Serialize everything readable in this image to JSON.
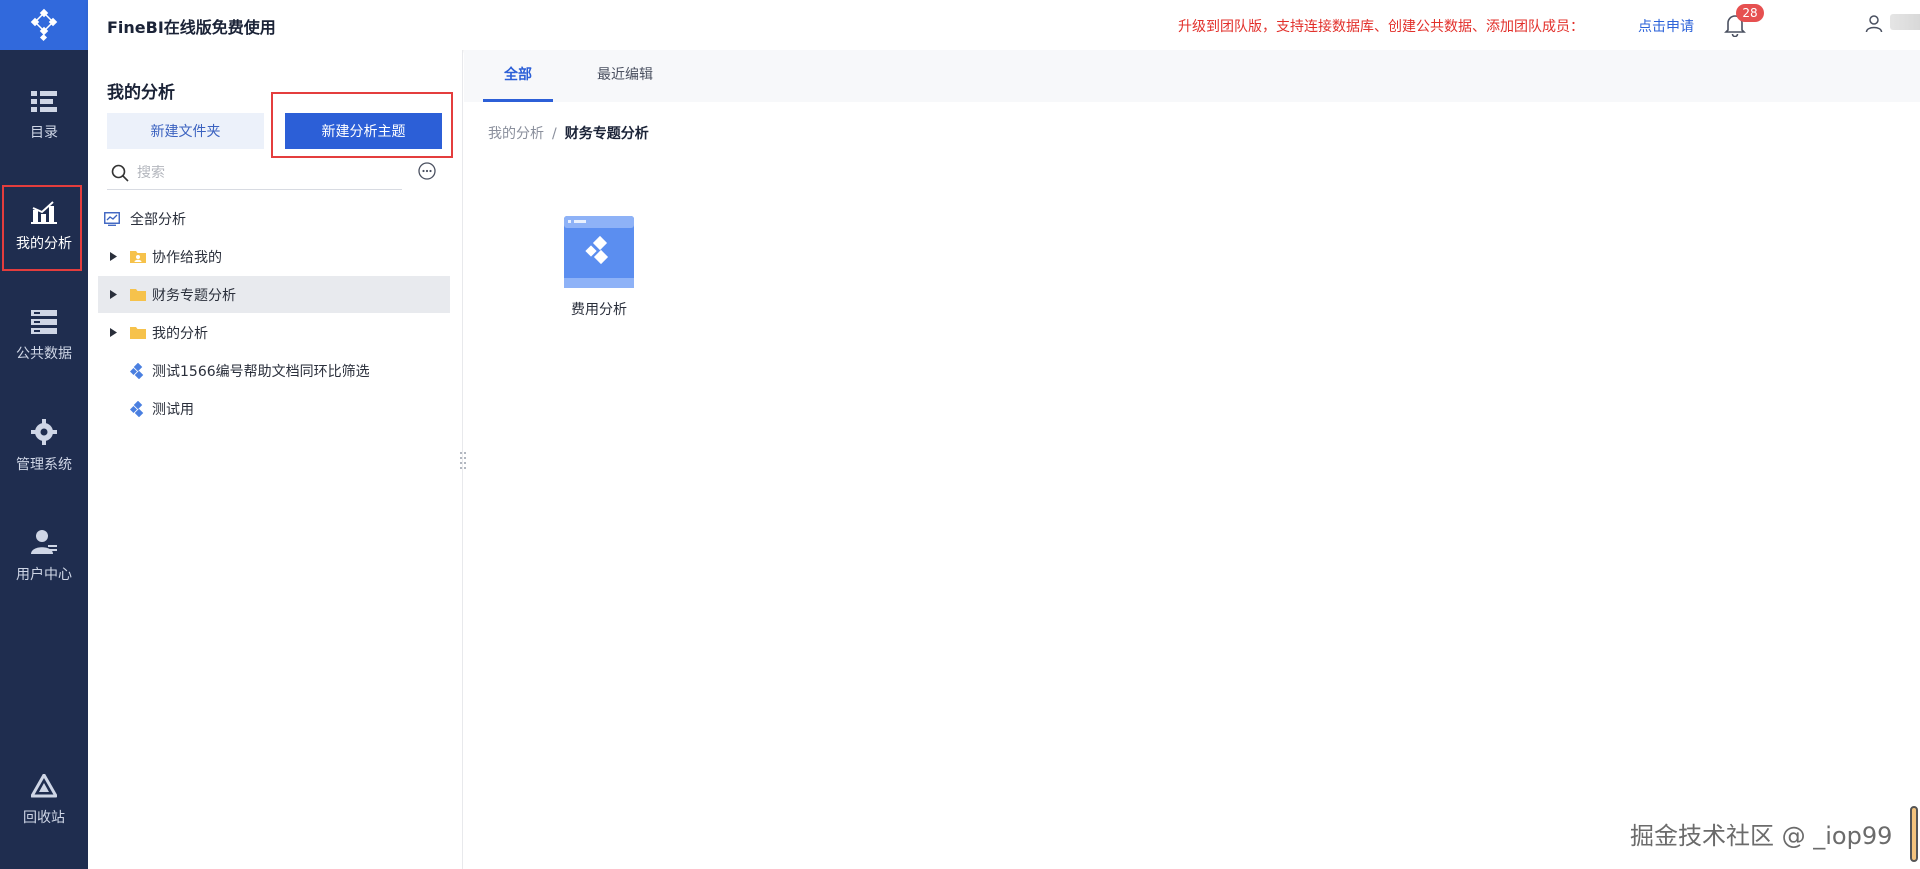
{
  "app": {
    "title": "FineBI在线版免费使用"
  },
  "header": {
    "promo_text": "升级到团队版，支持连接数据库、创建公共数据、添加团队成员：",
    "apply_link": "点击申请",
    "notification_count": "28"
  },
  "nav": {
    "items": [
      {
        "label": "目录",
        "icon": "catalog-icon"
      },
      {
        "label": "我的分析",
        "icon": "analysis-icon",
        "active": true
      },
      {
        "label": "公共数据",
        "icon": "database-icon"
      },
      {
        "label": "管理系统",
        "icon": "gear-icon"
      },
      {
        "label": "用户中心",
        "icon": "user-center-icon"
      },
      {
        "label": "回收站",
        "icon": "recycle-icon"
      }
    ]
  },
  "sidepanel": {
    "title": "我的分析",
    "new_folder_label": "新建文件夹",
    "new_subject_label": "新建分析主题",
    "search_placeholder": "搜索",
    "tree": [
      {
        "label": "全部分析",
        "icon": "chart-monitor-icon"
      },
      {
        "label": "协作给我的",
        "icon": "shared-folder-icon",
        "expandable": true
      },
      {
        "label": "财务专题分析",
        "icon": "folder-icon",
        "expandable": true,
        "selected": true
      },
      {
        "label": "我的分析",
        "icon": "folder-icon",
        "expandable": true
      },
      {
        "label": "测试1566编号帮助文档同环比筛选",
        "icon": "subject-icon"
      },
      {
        "label": "测试用",
        "icon": "subject-icon"
      }
    ]
  },
  "main": {
    "tabs": [
      {
        "label": "全部",
        "active": true
      },
      {
        "label": "最近编辑"
      }
    ],
    "breadcrumb": {
      "root": "我的分析",
      "separator": "/",
      "current": "财务专题分析"
    },
    "cards": [
      {
        "label": "费用分析",
        "icon": "analysis-subject-icon"
      }
    ]
  },
  "watermark": "掘金技术社区 @ _iop99",
  "colors": {
    "nav_bg": "#1f2d4f",
    "brand_blue": "#2c5fd7",
    "promo_red": "#e2302b",
    "highlight_red": "#e43d3d"
  }
}
